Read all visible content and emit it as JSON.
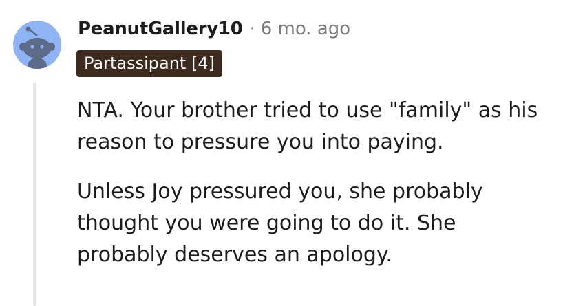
{
  "comment": {
    "author": "PeanutGallery10",
    "separator": "·",
    "timestamp": "6 mo. ago",
    "flair": "Partassipant [4]",
    "avatar_icon": "snoo-avatar-icon",
    "paragraphs": [
      "NTA. Your brother tried to use \"family\" as his reason to pressure you into paying.",
      "Unless Joy pressured you, she probably thought you were going to do it. She probably deserves an apology."
    ]
  },
  "colors": {
    "avatar_bg": "#8fb4f6",
    "flair_bg": "#3d2b20",
    "muted_text": "#7c7c7c",
    "thread_line": "#e6e7e8"
  }
}
